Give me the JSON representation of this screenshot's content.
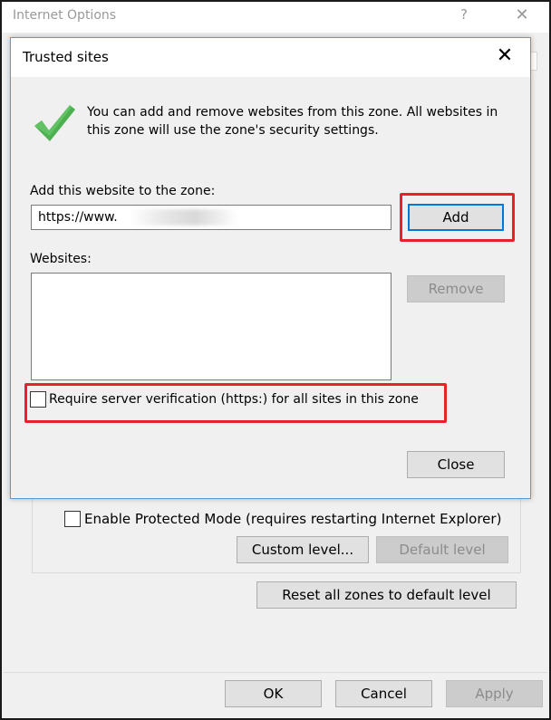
{
  "parent_window": {
    "title": "Internet Options",
    "help_label": "?",
    "close_label": "✕",
    "protected_mode_label": "Enable Protected Mode (requires restarting Internet Explorer)",
    "custom_level_label": "Custom level...",
    "default_level_label": "Default level",
    "reset_zones_label": "Reset all zones to default level",
    "ok_label": "OK",
    "cancel_label": "Cancel",
    "apply_label": "Apply"
  },
  "dialog": {
    "title": "Trusted sites",
    "close_label": "✕",
    "intro_text": "You can add and remove websites from this zone. All websites in this zone will use the zone's security settings.",
    "add_label": "Add this website to the zone:",
    "url_value": "https://www.",
    "add_button_label": "Add",
    "websites_label": "Websites:",
    "websites": [],
    "remove_button_label": "Remove",
    "https_checkbox_label": "Require server verification (https:) for all sites in this zone",
    "https_checked": false,
    "close_button_label": "Close"
  },
  "colors": {
    "accent": "#0078d7",
    "highlight": "#e8212b",
    "checkmark": "#4caf50"
  }
}
